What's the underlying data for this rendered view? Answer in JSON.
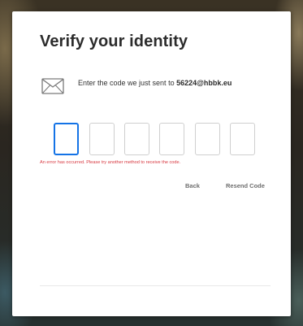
{
  "dialog": {
    "title": "Verify your identity",
    "icon": "envelope-icon",
    "sent_prefix": "Enter the code we just sent to ",
    "sent_email": "56224@hbbk.eu",
    "code_boxes": [
      "",
      "",
      "",
      "",
      "",
      ""
    ],
    "error": "An error has occurred. Please try another method to receive the code.",
    "back_label": "Back",
    "resend_label": "Resend Code"
  },
  "colors": {
    "focus_border": "#1473e6",
    "error_text": "#d7373f",
    "title_text": "#2c2c2c",
    "link_text": "#6e6e6e"
  }
}
